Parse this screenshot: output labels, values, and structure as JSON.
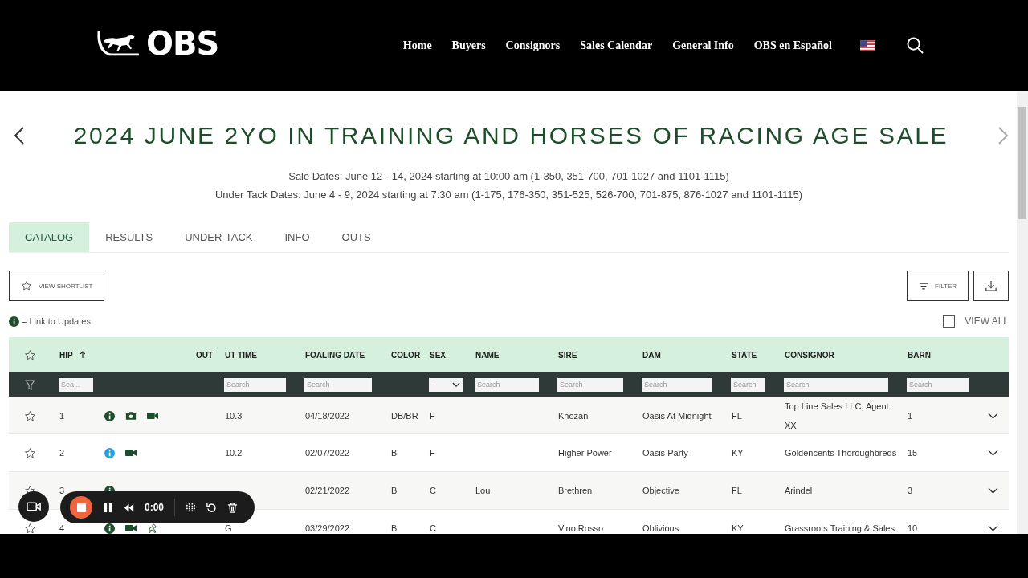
{
  "header": {
    "logo": "OBS",
    "nav": [
      "Home",
      "Buyers",
      "Consignors",
      "Sales Calendar",
      "General Info",
      "OBS en Español"
    ]
  },
  "title": "2024 JUNE 2YO IN TRAINING AND HORSES OF RACING AGE SALE",
  "dates": [
    "Sale Dates: June 12 - 14, 2024 starting at 10:00 am (1-350, 351-700, 701-1027 and 1101-1115)",
    "Under Tack Dates: June 4 - 9, 2024 starting at 7:30 am (1-175, 176-350, 351-525, 526-700, 701-875, 876-1027 and 1101-1115)"
  ],
  "tabs": [
    {
      "label": "CATALOG",
      "selected": true
    },
    {
      "label": "RESULTS",
      "selected": false
    },
    {
      "label": "UNDER-TACK",
      "selected": false
    },
    {
      "label": "INFO",
      "selected": false
    },
    {
      "label": "OUTS",
      "selected": false
    }
  ],
  "toolbar": {
    "shortlist": "VIEW SHORTLIST",
    "filter": "FILTER",
    "legend": "= Link to Updates",
    "view_all": {
      "label": "VIEW ALL",
      "checked": false
    }
  },
  "table": {
    "columns": [
      {
        "kind": "star"
      },
      {
        "kind": "text",
        "label": "HIP",
        "sorted": true,
        "filter": {
          "kind": "search",
          "placeholder": "Sea..."
        }
      },
      {
        "kind": "icons"
      },
      {
        "kind": "text",
        "label": "OUT"
      },
      {
        "kind": "text",
        "label": "UT TIME",
        "filter": {
          "kind": "search",
          "placeholder": "Search"
        }
      },
      {
        "kind": "text",
        "label": "FOALING DATE",
        "filter": {
          "kind": "search",
          "placeholder": "Search"
        }
      },
      {
        "kind": "text",
        "label": "COLOR"
      },
      {
        "kind": "text",
        "label": "SEX",
        "filter": {
          "kind": "select",
          "value": "-"
        }
      },
      {
        "kind": "text",
        "label": "NAME",
        "filter": {
          "kind": "search",
          "placeholder": "Search"
        }
      },
      {
        "kind": "text",
        "label": "SIRE",
        "filter": {
          "kind": "search",
          "placeholder": "Search"
        }
      },
      {
        "kind": "text",
        "label": "DAM",
        "filter": {
          "kind": "search",
          "placeholder": "Search"
        }
      },
      {
        "kind": "text",
        "label": "STATE",
        "filter": {
          "kind": "search",
          "placeholder": "Search"
        }
      },
      {
        "kind": "text",
        "label": "CONSIGNOR",
        "filter": {
          "kind": "search",
          "placeholder": "Search"
        }
      },
      {
        "kind": "text",
        "label": "BARN",
        "filter": {
          "kind": "search",
          "placeholder": "Search"
        }
      },
      {
        "kind": "expand"
      }
    ],
    "rows": [
      {
        "hip": "1",
        "icons": [
          {
            "kind": "info",
            "color": "#1e4d2b"
          },
          {
            "kind": "camera"
          },
          {
            "kind": "video"
          }
        ],
        "ut_time": "10.3",
        "foaling_date": "04/18/2022",
        "coat_color": "DB/BR",
        "sex": "F",
        "sire": "Khozan",
        "dam": "Oasis At Midnight",
        "state": "FL",
        "consignor": "Top Line Sales LLC, Agent XX",
        "barn": "1"
      },
      {
        "hip": "2",
        "icons": [
          {
            "kind": "info",
            "color": "#2b9fd8"
          },
          {
            "kind": "video"
          }
        ],
        "ut_time": "10.2",
        "foaling_date": "02/07/2022",
        "coat_color": "B",
        "sex": "F",
        "sire": "Higher Power",
        "dam": "Oasis Party",
        "state": "KY",
        "consignor": "Goldencents Thoroughbreds",
        "barn": "15"
      },
      {
        "hip": "3",
        "icons": [
          {
            "kind": "info",
            "color": "#1e4d2b"
          }
        ],
        "foaling_date": "02/21/2022",
        "coat_color": "B",
        "sex": "C",
        "name": "Lou",
        "sire": "Brethren",
        "dam": "Objective",
        "state": "FL",
        "consignor": "Arindel",
        "barn": "3"
      },
      {
        "hip": "4",
        "icons": [
          {
            "kind": "info",
            "color": "#1e4d2b"
          },
          {
            "kind": "video"
          },
          {
            "kind": "horse"
          }
        ],
        "ut_time": "G",
        "foaling_date": "03/29/2022",
        "coat_color": "B",
        "sex": "C",
        "sire": "Vino Rosso",
        "dam": "Oblivious",
        "state": "KY",
        "consignor": "Grassroots Training & Sales",
        "barn": "10"
      }
    ]
  },
  "recorder": {
    "time": "0:00"
  }
}
